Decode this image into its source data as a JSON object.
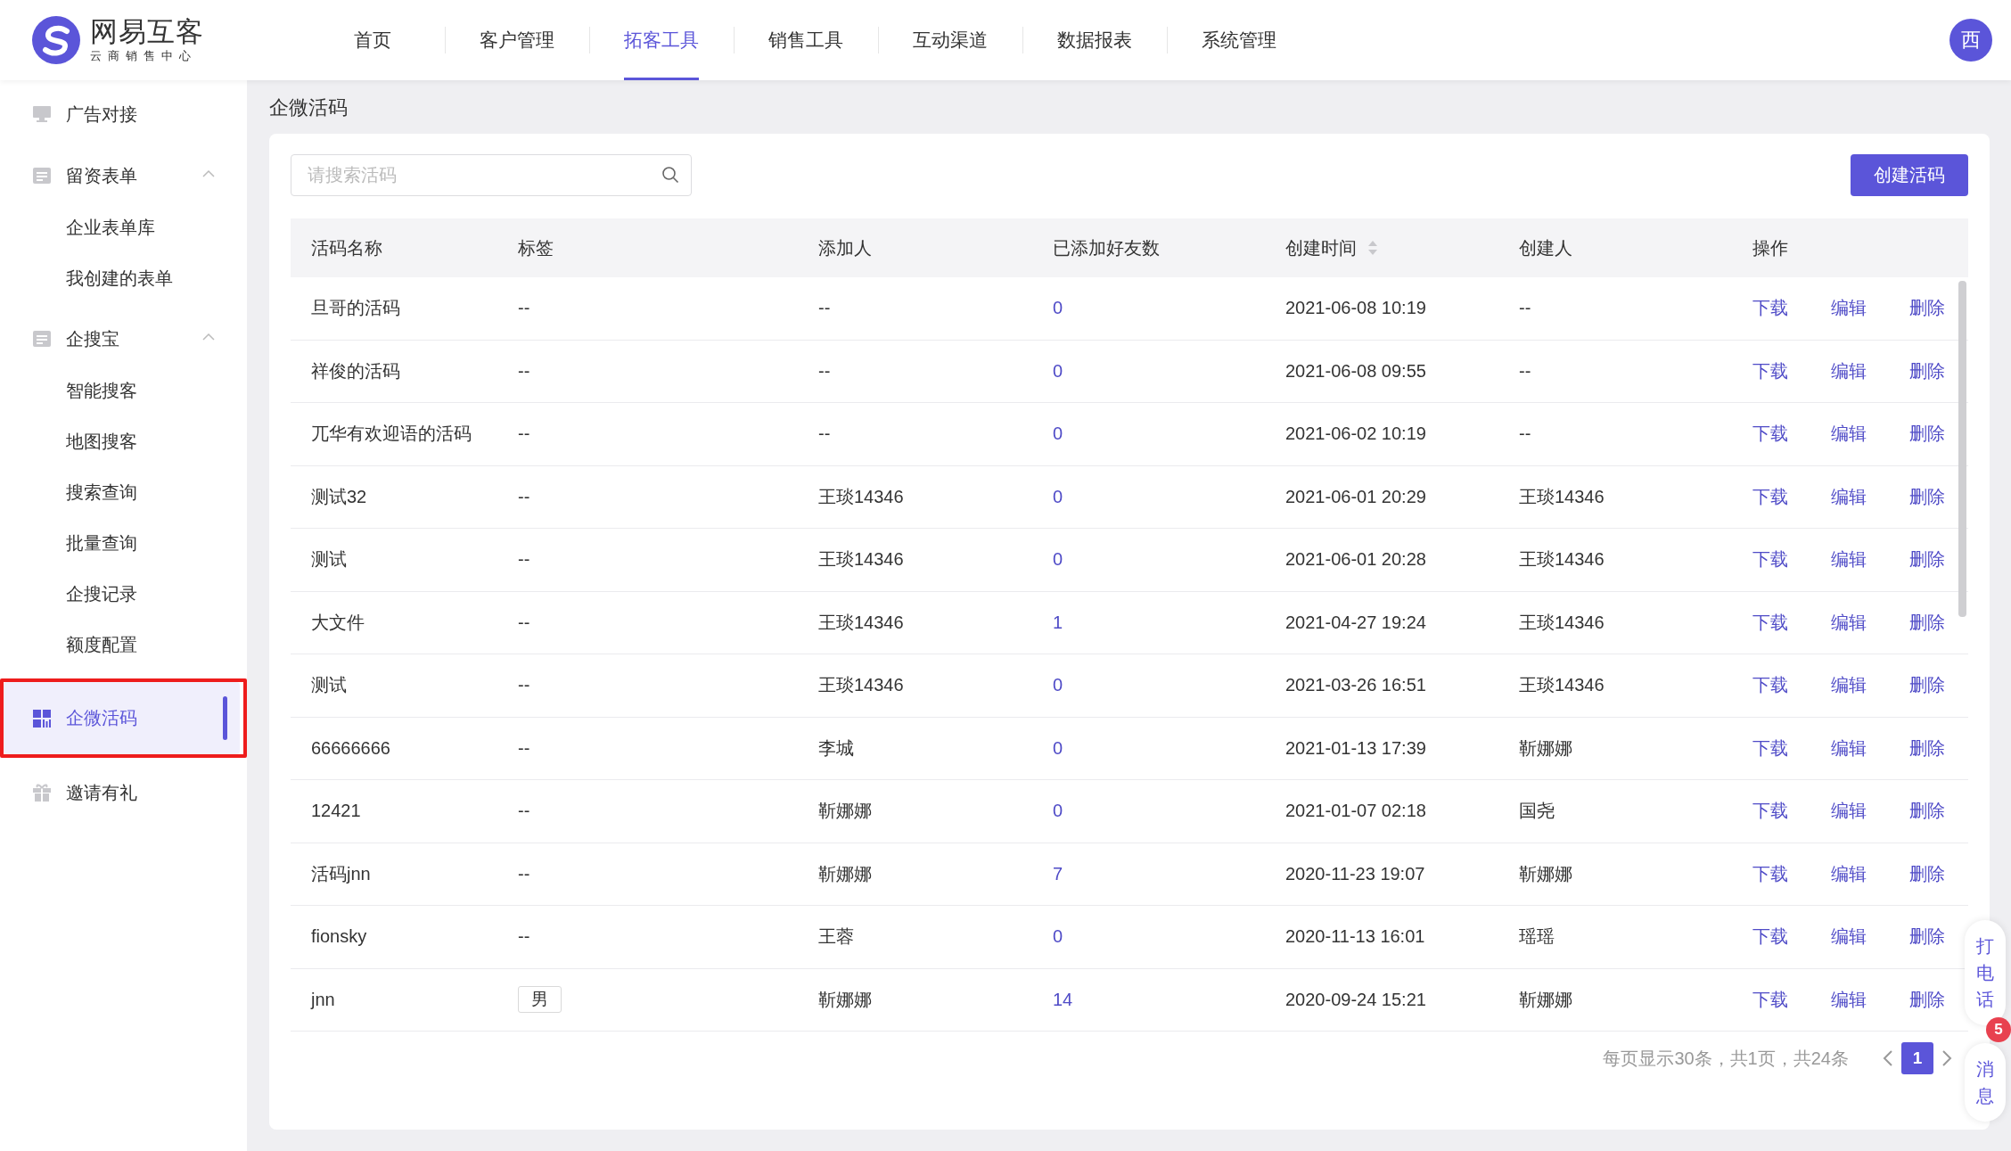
{
  "header": {
    "logo": {
      "name": "网易互客",
      "tagline": "云商销售中心"
    },
    "tabs": [
      {
        "label": "首页",
        "selected": false
      },
      {
        "label": "客户管理",
        "selected": false
      },
      {
        "label": "拓客工具",
        "selected": true
      },
      {
        "label": "销售工具",
        "selected": false
      },
      {
        "label": "互动渠道",
        "selected": false
      },
      {
        "label": "数据报表",
        "selected": false
      },
      {
        "label": "系统管理",
        "selected": false
      }
    ],
    "avatar": "西"
  },
  "sidebar": {
    "items": [
      {
        "label": "广告对接",
        "selected": false,
        "highlighted": false
      },
      {
        "label": "留资表单",
        "selected": false,
        "highlighted": false,
        "expanded": true,
        "children": [
          {
            "label": "企业表单库",
            "selected": false
          },
          {
            "label": "我创建的表单",
            "selected": false
          }
        ]
      },
      {
        "label": "企搜宝",
        "selected": false,
        "highlighted": false,
        "expanded": true,
        "children": [
          {
            "label": "智能搜客",
            "selected": false
          },
          {
            "label": "地图搜客",
            "selected": false
          },
          {
            "label": "搜索查询",
            "selected": false
          },
          {
            "label": "批量查询",
            "selected": false
          },
          {
            "label": "企搜记录",
            "selected": false
          },
          {
            "label": "额度配置",
            "selected": false
          }
        ]
      },
      {
        "label": "企微活码",
        "selected": true,
        "highlighted": true
      },
      {
        "label": "邀请有礼",
        "selected": false,
        "highlighted": false
      }
    ]
  },
  "page_title": "企微活码",
  "search": {
    "placeholder": "请搜索活码"
  },
  "create_button": "创建活码",
  "table": {
    "columns": [
      {
        "label": "活码名称",
        "sortable": false
      },
      {
        "label": "标签",
        "sortable": false
      },
      {
        "label": "添加人",
        "sortable": false
      },
      {
        "label": "已添加好友数",
        "sortable": false
      },
      {
        "label": "创建时间",
        "sortable": true
      },
      {
        "label": "创建人",
        "sortable": false
      },
      {
        "label": "操作",
        "sortable": false
      }
    ],
    "rows": [
      {
        "name": "旦哥的活码",
        "tag": "--",
        "chip": false,
        "adder": "--",
        "friends": "0",
        "created": "2021-06-08 10:19",
        "creator": "--",
        "actions": [
          "下载",
          "编辑",
          "删除"
        ]
      },
      {
        "name": "祥俊的活码",
        "tag": "--",
        "chip": false,
        "adder": "--",
        "friends": "0",
        "created": "2021-06-08 09:55",
        "creator": "--",
        "actions": [
          "下载",
          "编辑",
          "删除"
        ]
      },
      {
        "name": "兀华有欢迎语的活码",
        "tag": "--",
        "chip": false,
        "adder": "--",
        "friends": "0",
        "created": "2021-06-02 10:19",
        "creator": "--",
        "actions": [
          "下载",
          "编辑",
          "删除"
        ]
      },
      {
        "name": "测试32",
        "tag": "--",
        "chip": false,
        "adder": "王琰14346",
        "friends": "0",
        "created": "2021-06-01 20:29",
        "creator": "王琰14346",
        "actions": [
          "下载",
          "编辑",
          "删除"
        ]
      },
      {
        "name": "测试",
        "tag": "--",
        "chip": false,
        "adder": "王琰14346",
        "friends": "0",
        "created": "2021-06-01 20:28",
        "creator": "王琰14346",
        "actions": [
          "下载",
          "编辑",
          "删除"
        ]
      },
      {
        "name": "大文件",
        "tag": "--",
        "chip": false,
        "adder": "王琰14346",
        "friends": "1",
        "created": "2021-04-27 19:24",
        "creator": "王琰14346",
        "actions": [
          "下载",
          "编辑",
          "删除"
        ]
      },
      {
        "name": "测试",
        "tag": "--",
        "chip": false,
        "adder": "王琰14346",
        "friends": "0",
        "created": "2021-03-26 16:51",
        "creator": "王琰14346",
        "actions": [
          "下载",
          "编辑",
          "删除"
        ]
      },
      {
        "name": "66666666",
        "tag": "--",
        "chip": false,
        "adder": "李城",
        "friends": "0",
        "created": "2021-01-13 17:39",
        "creator": "靳娜娜",
        "actions": [
          "下载",
          "编辑",
          "删除"
        ]
      },
      {
        "name": "12421",
        "tag": "--",
        "chip": false,
        "adder": "靳娜娜",
        "friends": "0",
        "created": "2021-01-07 02:18",
        "creator": "国尧",
        "actions": [
          "下载",
          "编辑",
          "删除"
        ]
      },
      {
        "name": "活码jnn",
        "tag": "--",
        "chip": false,
        "adder": "靳娜娜",
        "friends": "7",
        "created": "2020-11-23 19:07",
        "creator": "靳娜娜",
        "actions": [
          "下载",
          "编辑",
          "删除"
        ]
      },
      {
        "name": "fionsky",
        "tag": "--",
        "chip": false,
        "adder": "王蓉",
        "friends": "0",
        "created": "2020-11-13 16:01",
        "creator": "瑶瑶",
        "actions": [
          "下载",
          "编辑",
          "删除"
        ]
      },
      {
        "name": "jnn",
        "tag": "男",
        "chip": true,
        "adder": "靳娜娜",
        "friends": "14",
        "created": "2020-09-24 15:21",
        "creator": "靳娜娜",
        "actions": [
          "下载",
          "编辑",
          "删除"
        ]
      }
    ]
  },
  "pagination": {
    "summary": "每页显示30条，共1页，共24条",
    "pages": [
      {
        "label": "1",
        "selected": true
      }
    ]
  },
  "float": {
    "call": "打电话",
    "message": {
      "label": "消息",
      "badge": "5"
    }
  }
}
